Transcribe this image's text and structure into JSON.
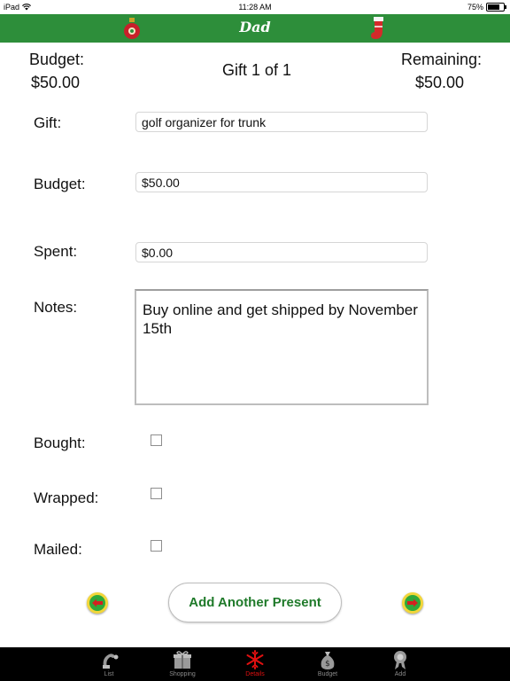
{
  "status_bar": {
    "device": "iPad",
    "time": "11:28 AM",
    "battery": "75%",
    "battery_level": 0.75
  },
  "nav": {
    "title": "Dad",
    "left_icon": "ornament-icon",
    "right_icon": "stocking-icon"
  },
  "summary": {
    "budget_label": "Budget:",
    "budget_value": "$50.00",
    "counter": "Gift 1 of 1",
    "remaining_label": "Remaining:",
    "remaining_value": "$50.00"
  },
  "form": {
    "gift_label": "Gift:",
    "gift_value": "golf organizer for trunk",
    "budget_label": "Budget:",
    "budget_value": "$50.00",
    "spent_label": "Spent:",
    "spent_value": "$0.00",
    "notes_label": "Notes:",
    "notes_value": "Buy online and get shipped by November 15th",
    "bought_label": "Bought:",
    "bought_checked": false,
    "wrapped_label": "Wrapped:",
    "wrapped_checked": false,
    "mailed_label": "Mailed:",
    "mailed_checked": false
  },
  "actions": {
    "prev_icon": "left-arrow-icon",
    "add_label": "Add Another Present",
    "next_icon": "right-arrow-icon"
  },
  "tabs": [
    {
      "label": "List",
      "icon": "santa-icon"
    },
    {
      "label": "Shopping",
      "icon": "gift-box-icon"
    },
    {
      "label": "Details",
      "icon": "snowflake-icon",
      "active": true
    },
    {
      "label": "Budget",
      "icon": "money-bag-icon"
    },
    {
      "label": "Add",
      "icon": "ribbon-icon"
    }
  ],
  "colors": {
    "nav_green": "#2d8e3a",
    "button_text": "#1f7a2a",
    "active_tab": "#e01010"
  }
}
